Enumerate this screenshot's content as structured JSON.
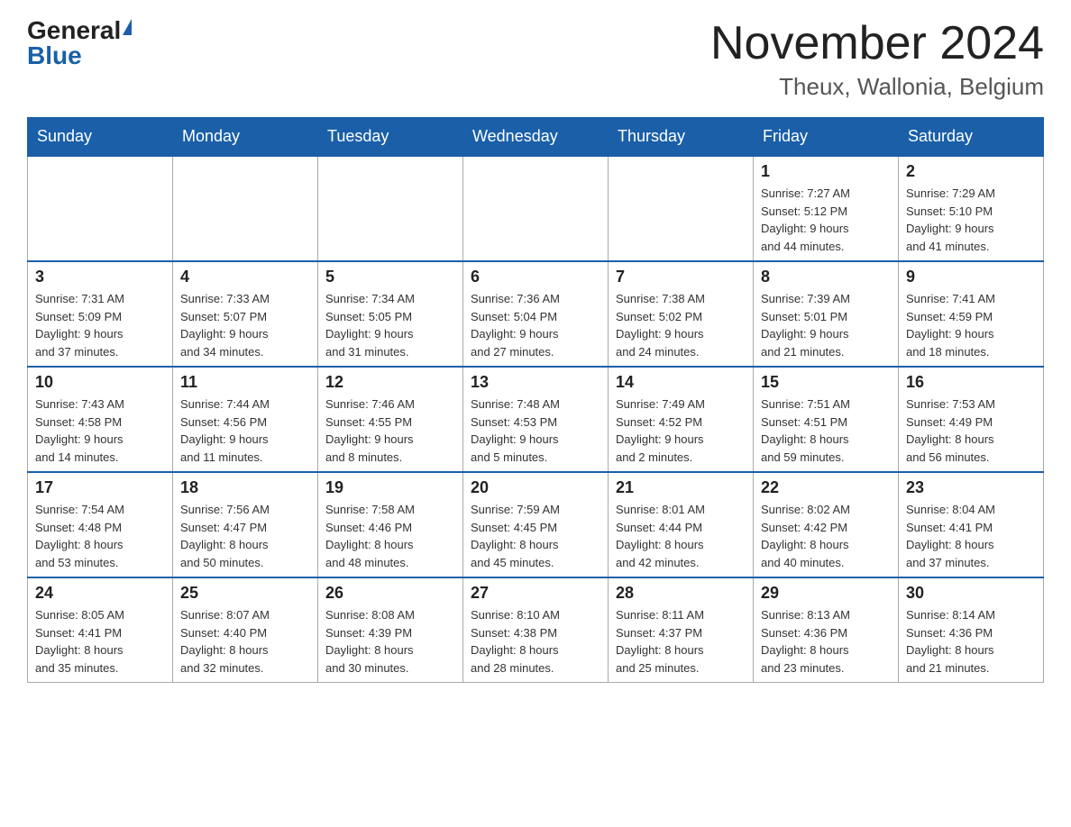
{
  "header": {
    "logo_general": "General",
    "logo_blue": "Blue",
    "title": "November 2024",
    "subtitle": "Theux, Wallonia, Belgium"
  },
  "days_of_week": [
    "Sunday",
    "Monday",
    "Tuesday",
    "Wednesday",
    "Thursday",
    "Friday",
    "Saturday"
  ],
  "weeks": [
    [
      {
        "day": "",
        "info": ""
      },
      {
        "day": "",
        "info": ""
      },
      {
        "day": "",
        "info": ""
      },
      {
        "day": "",
        "info": ""
      },
      {
        "day": "",
        "info": ""
      },
      {
        "day": "1",
        "info": "Sunrise: 7:27 AM\nSunset: 5:12 PM\nDaylight: 9 hours\nand 44 minutes."
      },
      {
        "day": "2",
        "info": "Sunrise: 7:29 AM\nSunset: 5:10 PM\nDaylight: 9 hours\nand 41 minutes."
      }
    ],
    [
      {
        "day": "3",
        "info": "Sunrise: 7:31 AM\nSunset: 5:09 PM\nDaylight: 9 hours\nand 37 minutes."
      },
      {
        "day": "4",
        "info": "Sunrise: 7:33 AM\nSunset: 5:07 PM\nDaylight: 9 hours\nand 34 minutes."
      },
      {
        "day": "5",
        "info": "Sunrise: 7:34 AM\nSunset: 5:05 PM\nDaylight: 9 hours\nand 31 minutes."
      },
      {
        "day": "6",
        "info": "Sunrise: 7:36 AM\nSunset: 5:04 PM\nDaylight: 9 hours\nand 27 minutes."
      },
      {
        "day": "7",
        "info": "Sunrise: 7:38 AM\nSunset: 5:02 PM\nDaylight: 9 hours\nand 24 minutes."
      },
      {
        "day": "8",
        "info": "Sunrise: 7:39 AM\nSunset: 5:01 PM\nDaylight: 9 hours\nand 21 minutes."
      },
      {
        "day": "9",
        "info": "Sunrise: 7:41 AM\nSunset: 4:59 PM\nDaylight: 9 hours\nand 18 minutes."
      }
    ],
    [
      {
        "day": "10",
        "info": "Sunrise: 7:43 AM\nSunset: 4:58 PM\nDaylight: 9 hours\nand 14 minutes."
      },
      {
        "day": "11",
        "info": "Sunrise: 7:44 AM\nSunset: 4:56 PM\nDaylight: 9 hours\nand 11 minutes."
      },
      {
        "day": "12",
        "info": "Sunrise: 7:46 AM\nSunset: 4:55 PM\nDaylight: 9 hours\nand 8 minutes."
      },
      {
        "day": "13",
        "info": "Sunrise: 7:48 AM\nSunset: 4:53 PM\nDaylight: 9 hours\nand 5 minutes."
      },
      {
        "day": "14",
        "info": "Sunrise: 7:49 AM\nSunset: 4:52 PM\nDaylight: 9 hours\nand 2 minutes."
      },
      {
        "day": "15",
        "info": "Sunrise: 7:51 AM\nSunset: 4:51 PM\nDaylight: 8 hours\nand 59 minutes."
      },
      {
        "day": "16",
        "info": "Sunrise: 7:53 AM\nSunset: 4:49 PM\nDaylight: 8 hours\nand 56 minutes."
      }
    ],
    [
      {
        "day": "17",
        "info": "Sunrise: 7:54 AM\nSunset: 4:48 PM\nDaylight: 8 hours\nand 53 minutes."
      },
      {
        "day": "18",
        "info": "Sunrise: 7:56 AM\nSunset: 4:47 PM\nDaylight: 8 hours\nand 50 minutes."
      },
      {
        "day": "19",
        "info": "Sunrise: 7:58 AM\nSunset: 4:46 PM\nDaylight: 8 hours\nand 48 minutes."
      },
      {
        "day": "20",
        "info": "Sunrise: 7:59 AM\nSunset: 4:45 PM\nDaylight: 8 hours\nand 45 minutes."
      },
      {
        "day": "21",
        "info": "Sunrise: 8:01 AM\nSunset: 4:44 PM\nDaylight: 8 hours\nand 42 minutes."
      },
      {
        "day": "22",
        "info": "Sunrise: 8:02 AM\nSunset: 4:42 PM\nDaylight: 8 hours\nand 40 minutes."
      },
      {
        "day": "23",
        "info": "Sunrise: 8:04 AM\nSunset: 4:41 PM\nDaylight: 8 hours\nand 37 minutes."
      }
    ],
    [
      {
        "day": "24",
        "info": "Sunrise: 8:05 AM\nSunset: 4:41 PM\nDaylight: 8 hours\nand 35 minutes."
      },
      {
        "day": "25",
        "info": "Sunrise: 8:07 AM\nSunset: 4:40 PM\nDaylight: 8 hours\nand 32 minutes."
      },
      {
        "day": "26",
        "info": "Sunrise: 8:08 AM\nSunset: 4:39 PM\nDaylight: 8 hours\nand 30 minutes."
      },
      {
        "day": "27",
        "info": "Sunrise: 8:10 AM\nSunset: 4:38 PM\nDaylight: 8 hours\nand 28 minutes."
      },
      {
        "day": "28",
        "info": "Sunrise: 8:11 AM\nSunset: 4:37 PM\nDaylight: 8 hours\nand 25 minutes."
      },
      {
        "day": "29",
        "info": "Sunrise: 8:13 AM\nSunset: 4:36 PM\nDaylight: 8 hours\nand 23 minutes."
      },
      {
        "day": "30",
        "info": "Sunrise: 8:14 AM\nSunset: 4:36 PM\nDaylight: 8 hours\nand 21 minutes."
      }
    ]
  ]
}
